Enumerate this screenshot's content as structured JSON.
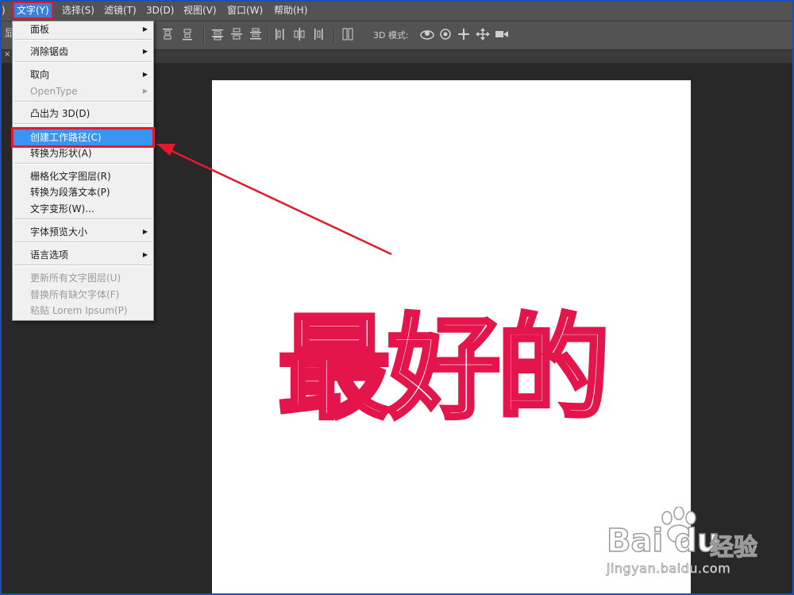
{
  "menubar": {
    "items": [
      {
        "label": ")"
      },
      {
        "label": "文字(Y)"
      },
      {
        "label": "选择(S)"
      },
      {
        "label": "滤镜(T)"
      },
      {
        "label": "3D(D)"
      },
      {
        "label": "视图(V)"
      },
      {
        "label": "窗口(W)"
      },
      {
        "label": "帮助(H)"
      }
    ],
    "active_index": 1
  },
  "options_bar": {
    "left_glyph": "显",
    "mode_label": "3D 模式:"
  },
  "tab": {
    "close_glyph": "×"
  },
  "menu": {
    "items": [
      {
        "label": "面板",
        "submenu": true,
        "disabled": false
      },
      {
        "label": "消除锯齿",
        "submenu": true,
        "disabled": false
      },
      {
        "label": "取向",
        "submenu": true,
        "disabled": false
      },
      {
        "label": "OpenType",
        "submenu": true,
        "disabled": true
      },
      {
        "label": "凸出为 3D(D)",
        "submenu": false,
        "disabled": false
      },
      {
        "label": "创建工作路径(C)",
        "submenu": false,
        "disabled": false,
        "highlighted": true
      },
      {
        "label": "转换为形状(A)",
        "submenu": false,
        "disabled": false
      },
      {
        "label": "栅格化文字图层(R)",
        "submenu": false,
        "disabled": false
      },
      {
        "label": "转换为段落文本(P)",
        "submenu": false,
        "disabled": false
      },
      {
        "label": "文字变形(W)...",
        "submenu": false,
        "disabled": false
      },
      {
        "label": "字体预览大小",
        "submenu": true,
        "disabled": false
      },
      {
        "label": "语言选项",
        "submenu": true,
        "disabled": false
      },
      {
        "label": "更新所有文字图层(U)",
        "submenu": false,
        "disabled": true
      },
      {
        "label": "替换所有缺欠字体(F)",
        "submenu": false,
        "disabled": true
      },
      {
        "label": "粘贴 Lorem Ipsum(P)",
        "submenu": false,
        "disabled": true
      }
    ],
    "submenu_glyph": "▶"
  },
  "canvas": {
    "text": "最好的",
    "stroke_color": "#e4154b"
  },
  "annotation": {
    "color": "#e11a2d"
  },
  "watermark": {
    "brand": "Bai  du",
    "brand_cn": "经验",
    "url": "jingyan.baidu.com"
  }
}
